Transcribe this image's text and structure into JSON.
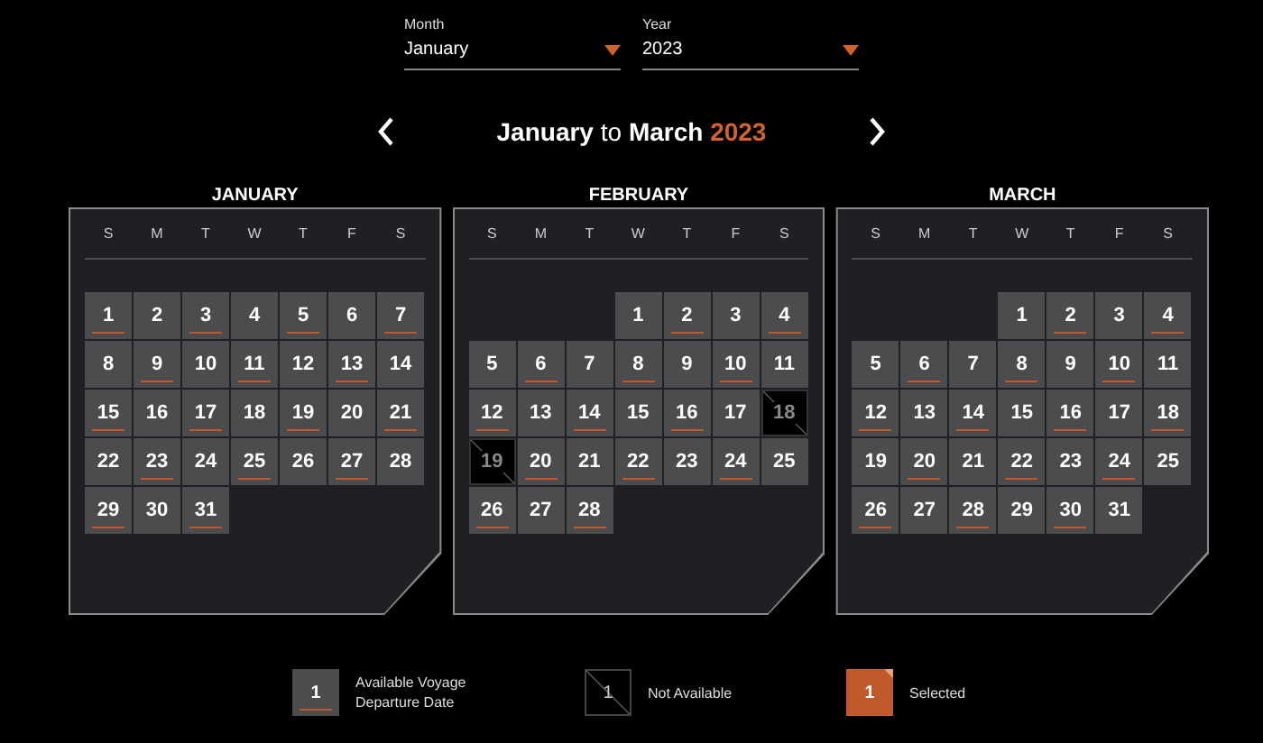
{
  "selectors": [
    {
      "label": "Month",
      "value": "January"
    },
    {
      "label": "Year",
      "value": "2023"
    }
  ],
  "range": {
    "from": "January",
    "joiner": "to",
    "to": "March",
    "year": "2023"
  },
  "months": [
    {
      "name": "JANUARY",
      "weekdays": [
        "S",
        "M",
        "T",
        "W",
        "T",
        "F",
        "S"
      ],
      "weeks": [
        {
          "days": [
            {
              "day": "1",
              "marked": true,
              "available": true
            },
            {
              "day": "2",
              "marked": false,
              "available": true
            },
            {
              "day": "3",
              "marked": true,
              "available": true
            },
            {
              "day": "4",
              "marked": false,
              "available": true
            },
            {
              "day": "5",
              "marked": true,
              "available": true
            },
            {
              "day": "6",
              "marked": false,
              "available": true
            },
            {
              "day": "7",
              "marked": true,
              "available": true
            }
          ]
        },
        {
          "days": [
            {
              "day": "8",
              "marked": false,
              "available": true
            },
            {
              "day": "9",
              "marked": true,
              "available": true
            },
            {
              "day": "10",
              "marked": false,
              "available": true
            },
            {
              "day": "11",
              "marked": true,
              "available": true
            },
            {
              "day": "12",
              "marked": false,
              "available": true
            },
            {
              "day": "13",
              "marked": true,
              "available": true
            },
            {
              "day": "14",
              "marked": false,
              "available": true
            }
          ]
        },
        {
          "days": [
            {
              "day": "15",
              "marked": true,
              "available": true
            },
            {
              "day": "16",
              "marked": false,
              "available": true
            },
            {
              "day": "17",
              "marked": true,
              "available": true
            },
            {
              "day": "18",
              "marked": false,
              "available": true
            },
            {
              "day": "19",
              "marked": true,
              "available": true
            },
            {
              "day": "20",
              "marked": false,
              "available": true
            },
            {
              "day": "21",
              "marked": true,
              "available": true
            }
          ]
        },
        {
          "days": [
            {
              "day": "22",
              "marked": false,
              "available": true
            },
            {
              "day": "23",
              "marked": true,
              "available": true
            },
            {
              "day": "24",
              "marked": false,
              "available": true
            },
            {
              "day": "25",
              "marked": true,
              "available": true
            },
            {
              "day": "26",
              "marked": false,
              "available": true
            },
            {
              "day": "27",
              "marked": true,
              "available": true
            },
            {
              "day": "28",
              "marked": false,
              "available": true
            }
          ]
        },
        {
          "days": [
            {
              "day": "29",
              "marked": true,
              "available": true
            },
            {
              "day": "30",
              "marked": false,
              "available": true
            },
            {
              "day": "31",
              "marked": true,
              "available": true
            }
          ]
        }
      ]
    },
    {
      "name": "FEBRUARY",
      "weekdays": [
        "S",
        "M",
        "T",
        "W",
        "T",
        "F",
        "S"
      ],
      "weeks": [
        {
          "right_aligned": true,
          "days": [
            {
              "day": "1",
              "marked": false,
              "available": true
            },
            {
              "day": "2",
              "marked": true,
              "available": true
            },
            {
              "day": "3",
              "marked": false,
              "available": true
            },
            {
              "day": "4",
              "marked": true,
              "available": true
            }
          ]
        },
        {
          "days": [
            {
              "day": "5",
              "marked": false,
              "available": true
            },
            {
              "day": "6",
              "marked": true,
              "available": true
            },
            {
              "day": "7",
              "marked": false,
              "available": true
            },
            {
              "day": "8",
              "marked": true,
              "available": true
            },
            {
              "day": "9",
              "marked": false,
              "available": true
            },
            {
              "day": "10",
              "marked": true,
              "available": true
            },
            {
              "day": "11",
              "marked": false,
              "available": true
            }
          ]
        },
        {
          "days": [
            {
              "day": "12",
              "marked": true,
              "available": true
            },
            {
              "day": "13",
              "marked": false,
              "available": true
            },
            {
              "day": "14",
              "marked": true,
              "available": true
            },
            {
              "day": "15",
              "marked": false,
              "available": true
            },
            {
              "day": "16",
              "marked": true,
              "available": true
            },
            {
              "day": "17",
              "marked": false,
              "available": true
            },
            {
              "day": "18",
              "available": false
            }
          ]
        },
        {
          "days": [
            {
              "day": "19",
              "available": false
            },
            {
              "day": "20",
              "marked": true,
              "available": true
            },
            {
              "day": "21",
              "marked": false,
              "available": true
            },
            {
              "day": "22",
              "marked": true,
              "available": true
            },
            {
              "day": "23",
              "marked": false,
              "available": true
            },
            {
              "day": "24",
              "marked": true,
              "available": true
            },
            {
              "day": "25",
              "marked": false,
              "available": true
            }
          ]
        },
        {
          "days": [
            {
              "day": "26",
              "marked": true,
              "available": true
            },
            {
              "day": "27",
              "marked": false,
              "available": true
            },
            {
              "day": "28",
              "marked": true,
              "available": true
            }
          ]
        }
      ]
    },
    {
      "name": "MARCH",
      "weekdays": [
        "S",
        "M",
        "T",
        "W",
        "T",
        "F",
        "S"
      ],
      "weeks": [
        {
          "right_aligned": true,
          "days": [
            {
              "day": "1",
              "marked": false,
              "available": true
            },
            {
              "day": "2",
              "marked": true,
              "available": true
            },
            {
              "day": "3",
              "marked": false,
              "available": true
            },
            {
              "day": "4",
              "marked": true,
              "available": true
            }
          ]
        },
        {
          "days": [
            {
              "day": "5",
              "marked": false,
              "available": true
            },
            {
              "day": "6",
              "marked": true,
              "available": true
            },
            {
              "day": "7",
              "marked": false,
              "available": true
            },
            {
              "day": "8",
              "marked": true,
              "available": true
            },
            {
              "day": "9",
              "marked": false,
              "available": true
            },
            {
              "day": "10",
              "marked": true,
              "available": true
            },
            {
              "day": "11",
              "marked": false,
              "available": true
            }
          ]
        },
        {
          "days": [
            {
              "day": "12",
              "marked": true,
              "available": true
            },
            {
              "day": "13",
              "marked": false,
              "available": true
            },
            {
              "day": "14",
              "marked": true,
              "available": true
            },
            {
              "day": "15",
              "marked": false,
              "available": true
            },
            {
              "day": "16",
              "marked": true,
              "available": true
            },
            {
              "day": "17",
              "marked": false,
              "available": true
            },
            {
              "day": "18",
              "marked": true,
              "available": true
            }
          ]
        },
        {
          "days": [
            {
              "day": "19",
              "marked": false,
              "available": true
            },
            {
              "day": "20",
              "marked": true,
              "available": true
            },
            {
              "day": "21",
              "marked": false,
              "available": true
            },
            {
              "day": "22",
              "marked": true,
              "available": true
            },
            {
              "day": "23",
              "marked": false,
              "available": true
            },
            {
              "day": "24",
              "marked": true,
              "available": true
            },
            {
              "day": "25",
              "marked": false,
              "available": true
            }
          ]
        },
        {
          "days": [
            {
              "day": "26",
              "marked": true,
              "available": true
            },
            {
              "day": "27",
              "marked": false,
              "available": true
            },
            {
              "day": "28",
              "marked": true,
              "available": true
            },
            {
              "day": "29",
              "marked": false,
              "available": true
            },
            {
              "day": "30",
              "marked": true,
              "available": true
            },
            {
              "day": "31",
              "marked": false,
              "available": true
            }
          ]
        }
      ]
    }
  ],
  "legend": [
    {
      "kind": "available",
      "sample": "1",
      "label": "Available Voyage Departure Date"
    },
    {
      "kind": "unavailable",
      "sample": "1",
      "label": "Not Available"
    },
    {
      "kind": "selected",
      "sample": "1",
      "label": "Selected"
    }
  ]
}
